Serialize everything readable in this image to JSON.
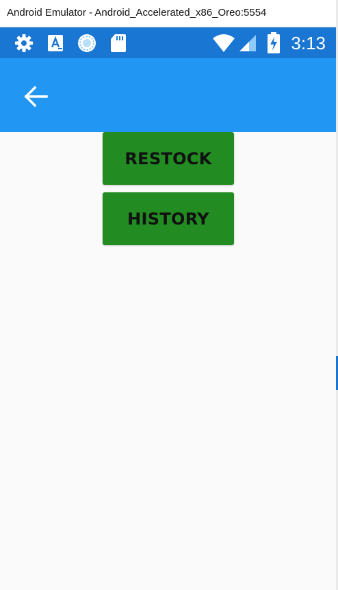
{
  "window": {
    "title": "Android Emulator - Android_Accelerated_x86_Oreo:5554"
  },
  "status_bar": {
    "time": "3:13",
    "left_icons": [
      "settings-icon",
      "a-notification-icon",
      "sync-icon",
      "sd-card-icon"
    ],
    "right_icons": [
      "wifi-icon",
      "cellular-signal-icon",
      "battery-charging-icon"
    ]
  },
  "toolbar": {
    "back_icon": "arrow-left-icon"
  },
  "main": {
    "restock_label": "RESTOCK",
    "history_label": "HISTORY"
  },
  "colors": {
    "title_bar": "#ffffff",
    "status_bar": "#1976d2",
    "toolbar": "#2196f3",
    "button": "#228b22",
    "background": "#fafafa"
  }
}
